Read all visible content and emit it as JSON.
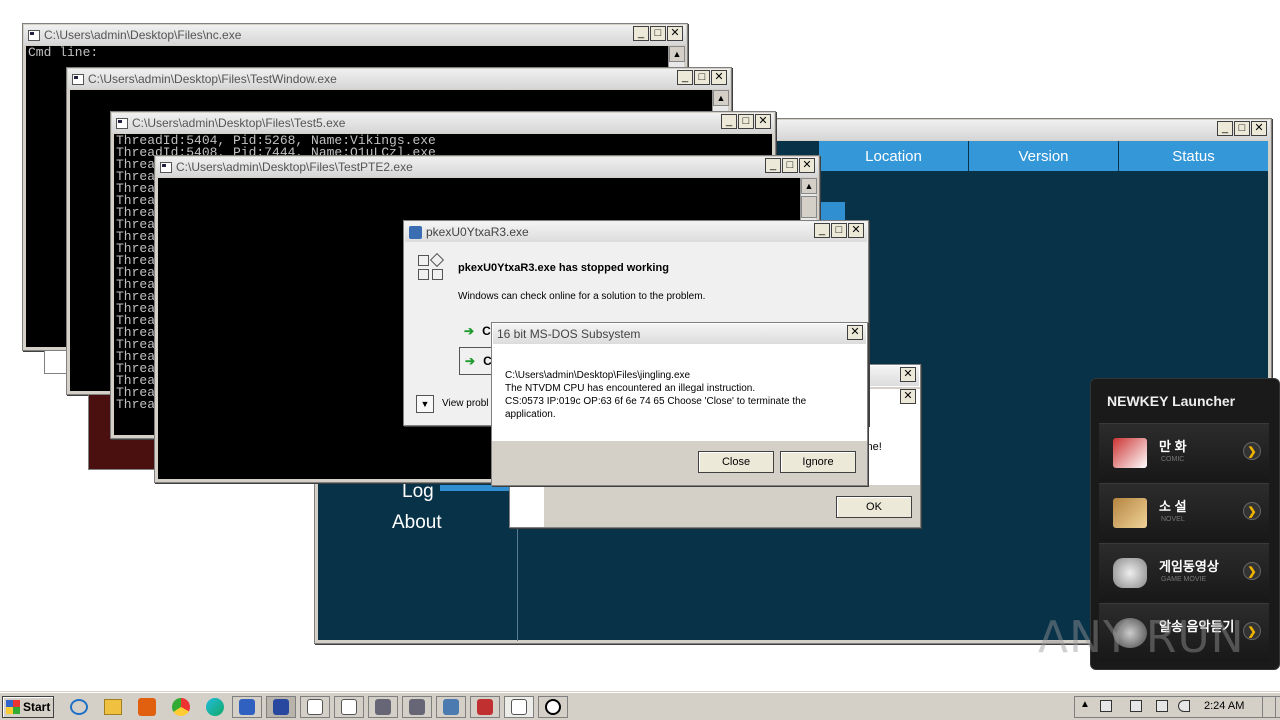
{
  "windows": {
    "nc": {
      "title": "C:\\Users\\admin\\Desktop\\Files\\nc.exe",
      "console_text": "Cmd line:"
    },
    "testwindow": {
      "title": "C:\\Users\\admin\\Desktop\\Files\\TestWindow.exe"
    },
    "test5": {
      "title": "C:\\Users\\admin\\Desktop\\Files\\Test5.exe",
      "lines": [
        "ThreadId:5404, Pid:5268, Name:Vikings.exe",
        "ThreadId:5408, Pid:7444, Name:Q1uLCzl.exe",
        "Threa",
        "Threa",
        "Threa",
        "Threa",
        "Threa",
        "Threa",
        "Threa",
        "Threa",
        "Threa",
        "Threa",
        "Threa",
        "Threa",
        "Threa",
        "Threa",
        "Threa",
        "Threa",
        "Threa",
        "Threa",
        "Threa",
        "Threa",
        "Threa"
      ]
    },
    "testpte2": {
      "title": "C:\\Users\\admin\\Desktop\\Files\\TestPTE2.exe"
    }
  },
  "app": {
    "columns": [
      "Location",
      "Version",
      "Status"
    ],
    "sidebar": [
      "Log",
      "About"
    ]
  },
  "stopped_dialog": {
    "title": "pkexU0YtxaR3.exe",
    "heading": "pkexU0YtxaR3.exe has stopped working",
    "message": "Windows can check online for a solution to the problem.",
    "option1": "C",
    "option2": "C",
    "view_problem": "View probl"
  },
  "msdos_dialog": {
    "title": "16 bit MS-DOS Subsystem",
    "path": "C:\\Users\\admin\\Desktop\\Files\\jingling.exe",
    "line2": "The NTVDM CPU has encountered an illegal instruction.",
    "line3": "CS:0573 IP:019c OP:63 6f 6e 74 65 Choose 'Close' to terminate the",
    "line4": "application.",
    "close_label": "Close",
    "ignore_label": "Ignore"
  },
  "back_dialog": {
    "partial_text": "hine!",
    "ok_label": "OK"
  },
  "launcher": {
    "title": "NEWKEY Launcher",
    "items": [
      {
        "title": "만 화",
        "sub": "COMIC"
      },
      {
        "title": "소 설",
        "sub": "NOVEL"
      },
      {
        "title": "게임동영상",
        "sub": "GAME MOVIE"
      },
      {
        "title": "알송 음악듣기",
        "sub": ""
      }
    ]
  },
  "watermark": "ANY RUN",
  "taskbar": {
    "start_label": "Start",
    "clock": "2:24 AM"
  }
}
